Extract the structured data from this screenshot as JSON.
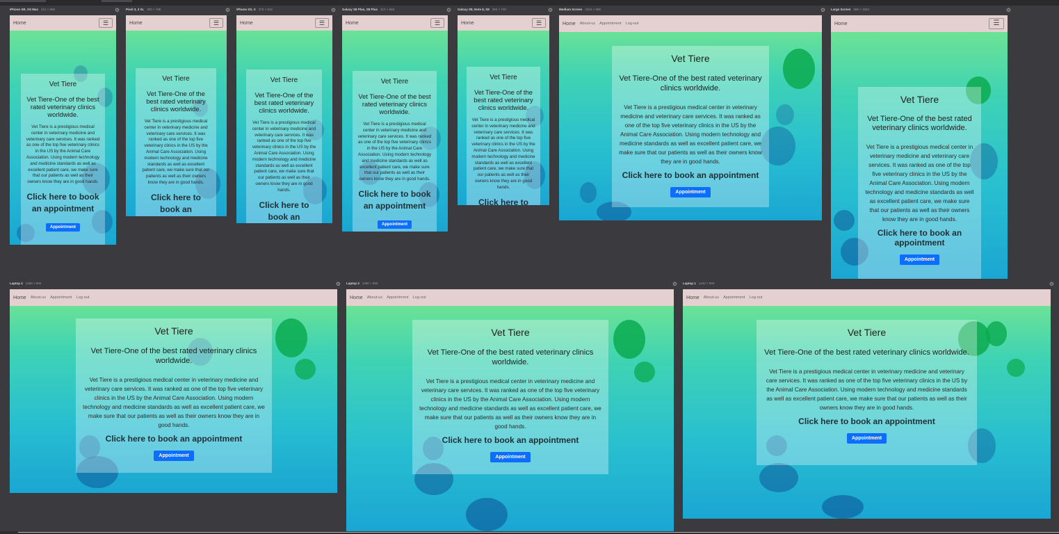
{
  "colors": {
    "canvas": "#3b3b3f",
    "navbar": "#e4cfd1",
    "button": "#0d6efd",
    "gradient_top": "#79e68d",
    "gradient_bottom": "#1aa6d3"
  },
  "nav": {
    "brand": "Home",
    "links": [
      "About-us",
      "Appointment",
      "Log-out"
    ],
    "menu_icon": "hamburger-icon"
  },
  "content": {
    "title": "Vet Tiere",
    "subtitle": "Vet Tiere-One of the best rated veterinary clinics worldwide.",
    "description": "Vet Tiere is a prestigious medical center in veterinary medicine and veterinary care services. It was ranked as one of the top five veterinary clinics in the US by the Animal Care Association. Using modern technology and medicine standards as well as excellent patient care, we make sure that our patients as well as their owners know they are in good hands.",
    "cta": "Click here to book an appointment",
    "button": "Appointment"
  },
  "frames": [
    {
      "name": "iPhone XR, XS Max",
      "dims": "414 × 896"
    },
    {
      "name": "Pixel 3, 3 XL",
      "dims": "393 × 786"
    },
    {
      "name": "iPhone XS, X",
      "dims": "375 × 812"
    },
    {
      "name": "Galaxy S8 Plus, S8 Plus",
      "dims": "412 × 846"
    },
    {
      "name": "Galaxy S8, Note 8, S8",
      "dims": "360 × 740"
    },
    {
      "name": "Medium Screen",
      "dims": "1024 × 665"
    },
    {
      "name": "Large Screen",
      "dims": "686 × 1024"
    },
    {
      "name": "Laptop 2",
      "dims": "1280 × 800"
    },
    {
      "name": "Laptop 3",
      "dims": "1280 × 950"
    },
    {
      "name": "Laptop 1",
      "dims": "1440 × 900"
    }
  ]
}
